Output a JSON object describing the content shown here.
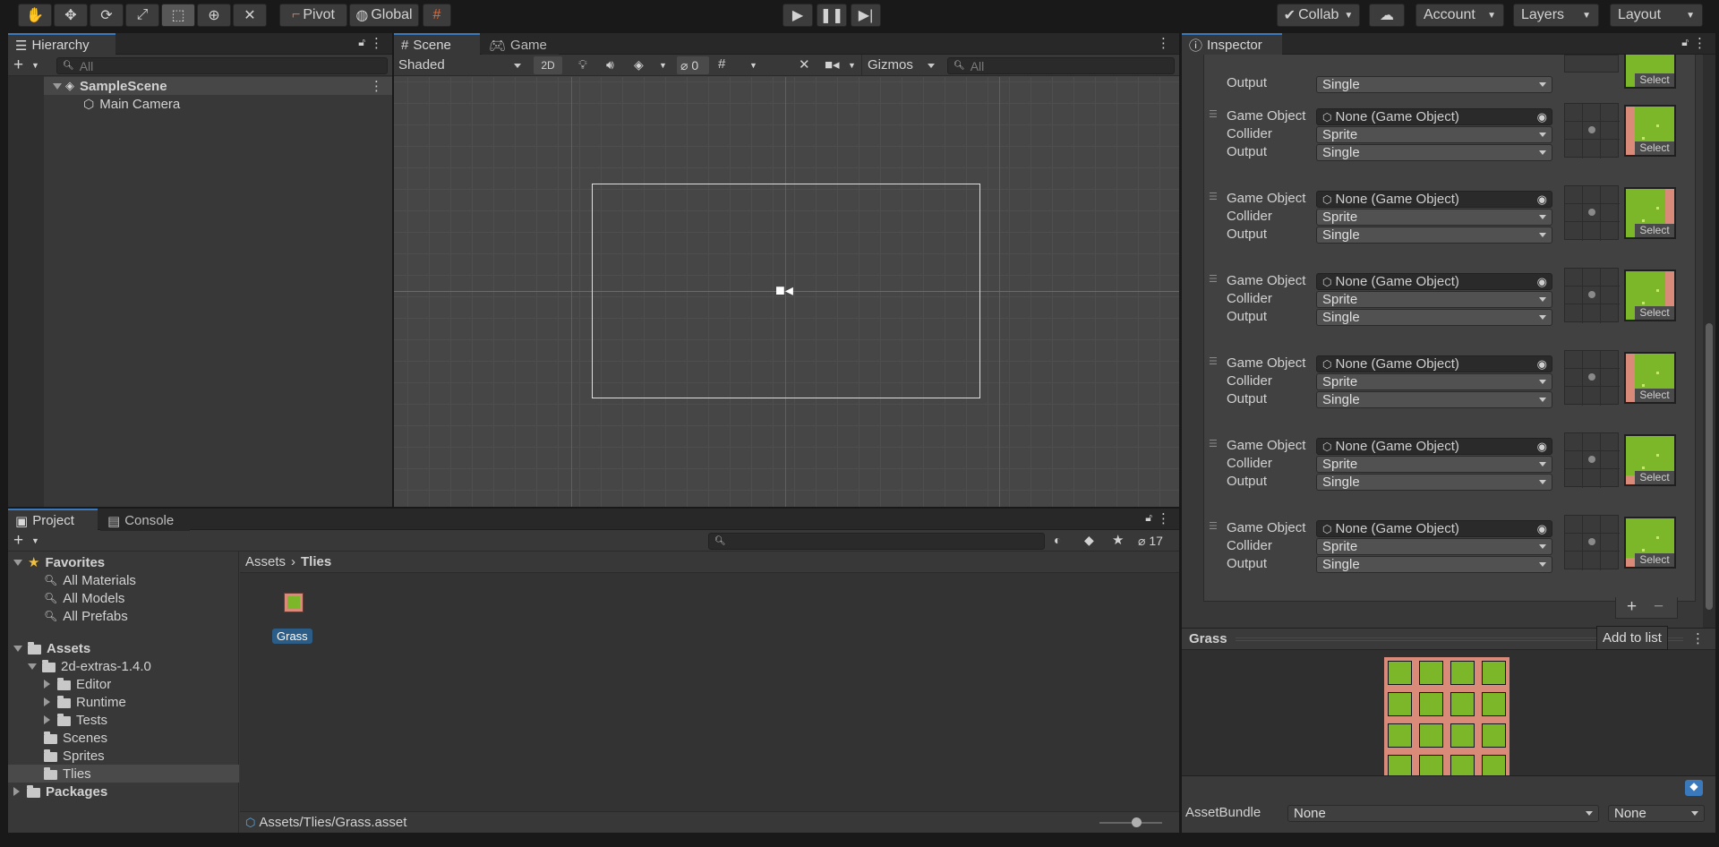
{
  "toolbar": {
    "pivot": "Pivot",
    "global": "Global",
    "collab": "Collab",
    "account": "Account",
    "layers": "Layers",
    "layout": "Layout"
  },
  "hierarchy": {
    "tab": "Hierarchy",
    "search_placeholder": "All",
    "scene": "SampleScene",
    "items": [
      "Main Camera"
    ]
  },
  "scene_view": {
    "tab_scene": "Scene",
    "tab_game": "Game",
    "shading": "Shaded",
    "mode_2d": "2D",
    "hidden_count": "0",
    "gizmos": "Gizmos",
    "search_placeholder": "All"
  },
  "project": {
    "tab_project": "Project",
    "tab_console": "Console",
    "hidden_count": "17",
    "favorites": {
      "label": "Favorites",
      "items": [
        "All Materials",
        "All Models",
        "All Prefabs"
      ]
    },
    "assets": {
      "label": "Assets",
      "extras": "2d-extras-1.4.0",
      "extras_children": [
        "Editor",
        "Runtime",
        "Tests"
      ],
      "children": [
        "Scenes",
        "Sprites",
        "Tlies"
      ],
      "packages": "Packages"
    },
    "breadcrumb": [
      "Assets",
      "Tlies"
    ],
    "asset_name": "Grass",
    "status_path": "Assets/Tlies/Grass.asset"
  },
  "inspector": {
    "tab": "Inspector",
    "top_output_label": "Output",
    "top_output_value": "Single",
    "select_label": "Select",
    "rules": [
      {
        "go_label": "Game Object",
        "go_value": "None (Game Object)",
        "collider_label": "Collider",
        "collider_value": "Sprite",
        "output_label": "Output",
        "output_value": "Single"
      },
      {
        "go_label": "Game Object",
        "go_value": "None (Game Object)",
        "collider_label": "Collider",
        "collider_value": "Sprite",
        "output_label": "Output",
        "output_value": "Single"
      },
      {
        "go_label": "Game Object",
        "go_value": "None (Game Object)",
        "collider_label": "Collider",
        "collider_value": "Sprite",
        "output_label": "Output",
        "output_value": "Single"
      },
      {
        "go_label": "Game Object",
        "go_value": "None (Game Object)",
        "collider_label": "Collider",
        "collider_value": "Sprite",
        "output_label": "Output",
        "output_value": "Single"
      },
      {
        "go_label": "Game Object",
        "go_value": "None (Game Object)",
        "collider_label": "Collider",
        "collider_value": "Sprite",
        "output_label": "Output",
        "output_value": "Single"
      },
      {
        "go_label": "Game Object",
        "go_value": "None (Game Object)",
        "collider_label": "Collider",
        "collider_value": "Sprite",
        "output_label": "Output",
        "output_value": "Single"
      }
    ],
    "add_to_list": "Add to list",
    "preview_title": "Grass",
    "assetbundle_label": "AssetBundle",
    "assetbundle_value": "None",
    "assetbundle_variant": "None"
  },
  "colors": {
    "accent": "#3a79bb",
    "grass": "#7cb729",
    "dirt": "#d98a78"
  }
}
